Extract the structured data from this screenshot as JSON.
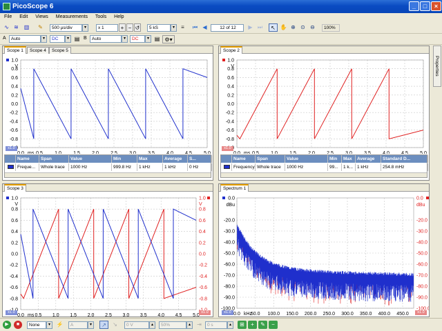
{
  "window": {
    "title": "PicoScope 6"
  },
  "menu": [
    "File",
    "Edit",
    "Views",
    "Measurements",
    "Tools",
    "Help"
  ],
  "toolbar": {
    "timebase": "500 µs/div",
    "zoom": "x 1",
    "samples": "5 kS",
    "capture_count": "12 of 12",
    "zoom_level": "100%",
    "channel_a": {
      "label": "A",
      "range": "Auto",
      "coupling": "DC"
    },
    "channel_b": {
      "label": "B",
      "range": "Auto",
      "coupling": "DC"
    }
  },
  "properties_tab": "Properties",
  "colors": {
    "channel_a": "#1f2fcc",
    "channel_b": "#e02020",
    "tab_accent": "#e8a000",
    "grid": "#c8c8c8"
  },
  "panels": {
    "scope1": {
      "tabs": [
        "Scope 1",
        "Scope 4",
        "Scope 5"
      ],
      "y_ticks": [
        "1.0",
        "0.8",
        "0.6",
        "0.4",
        "0.2",
        "0.0",
        "-0.2",
        "-0.4",
        "-0.6",
        "-0.8",
        "-1.0"
      ],
      "y_unit": "V",
      "x_ticks": [
        "0.0",
        "0.5",
        "1.0",
        "1.5",
        "2.0",
        "2.5",
        "3.0",
        "3.5",
        "4.0",
        "4.5",
        "5.0"
      ],
      "x_unit": "ms",
      "measurements": {
        "headers": [
          "Name",
          "Span",
          "Value",
          "Min",
          "Max",
          "Average",
          "S..."
        ],
        "row": [
          "Freque...",
          "Whole trace",
          "1000 Hz",
          "999.8 Hz",
          "1 kHz",
          "1 kHz",
          "0 Hz"
        ]
      }
    },
    "scope2": {
      "tabs": [
        "Scope 2"
      ],
      "y_ticks": [
        "1.0",
        "0.8",
        "0.6",
        "0.4",
        "0.2",
        "0.0",
        "-0.2",
        "-0.4",
        "-0.6",
        "-0.8",
        "-1.0"
      ],
      "y_unit": "V",
      "x_ticks": [
        "0.0",
        "0.5",
        "1.0",
        "1.5",
        "2.0",
        "2.5",
        "3.0",
        "3.5",
        "4.0",
        "4.5",
        "5.0"
      ],
      "x_unit": "ms",
      "measurements": {
        "headers": [
          "Name",
          "Span",
          "Value",
          "Min",
          "Max",
          "Average",
          "Standard D..."
        ],
        "row": [
          "Frequency",
          "Whole trace",
          "1000 Hz",
          "99...",
          "1 k...",
          "1 kHz",
          "254.8 mHz"
        ]
      }
    },
    "scope3": {
      "tabs": [
        "Scope 3"
      ],
      "y_ticks": [
        "1.0",
        "0.8",
        "0.6",
        "0.4",
        "0.2",
        "0.0",
        "-0.2",
        "-0.4",
        "-0.6",
        "-0.8",
        "-1.0"
      ],
      "y_unit_left": "V",
      "y_unit_right": "V",
      "right_ticks": [
        "0.8",
        "0.6",
        "0.4",
        "0.2",
        "0.0",
        "-0.2",
        "-0.4",
        "-0.6",
        "-0.8",
        "-1.0"
      ],
      "x_ticks": [
        "0.0",
        "0.5",
        "1.0",
        "1.5",
        "2.0",
        "2.5",
        "3.0",
        "3.5",
        "4.0",
        "4.5",
        "5.0"
      ],
      "x_unit": "ms"
    },
    "spectrum1": {
      "tabs": [
        "Spectrum 1"
      ],
      "left_top": "0.0",
      "right_top": "0.0",
      "y_unit": "dBu",
      "y_ticks": [
        "-20.0",
        "-30.0",
        "-40.0",
        "-50.0",
        "-60.0",
        "-70.0",
        "-80.0",
        "-90.0",
        "-100.0"
      ],
      "x_ticks": [
        "0.0",
        "50.0",
        "100.0",
        "150.0",
        "200.0",
        "250.0",
        "300.0",
        "350.0",
        "400.0",
        "450.0"
      ],
      "x_unit": "kHz"
    }
  },
  "statusbar": {
    "trigger_mode": "None",
    "trigger_source": "A",
    "threshold": "0 V",
    "pre_trigger": "50%",
    "delay": "0 s"
  }
}
